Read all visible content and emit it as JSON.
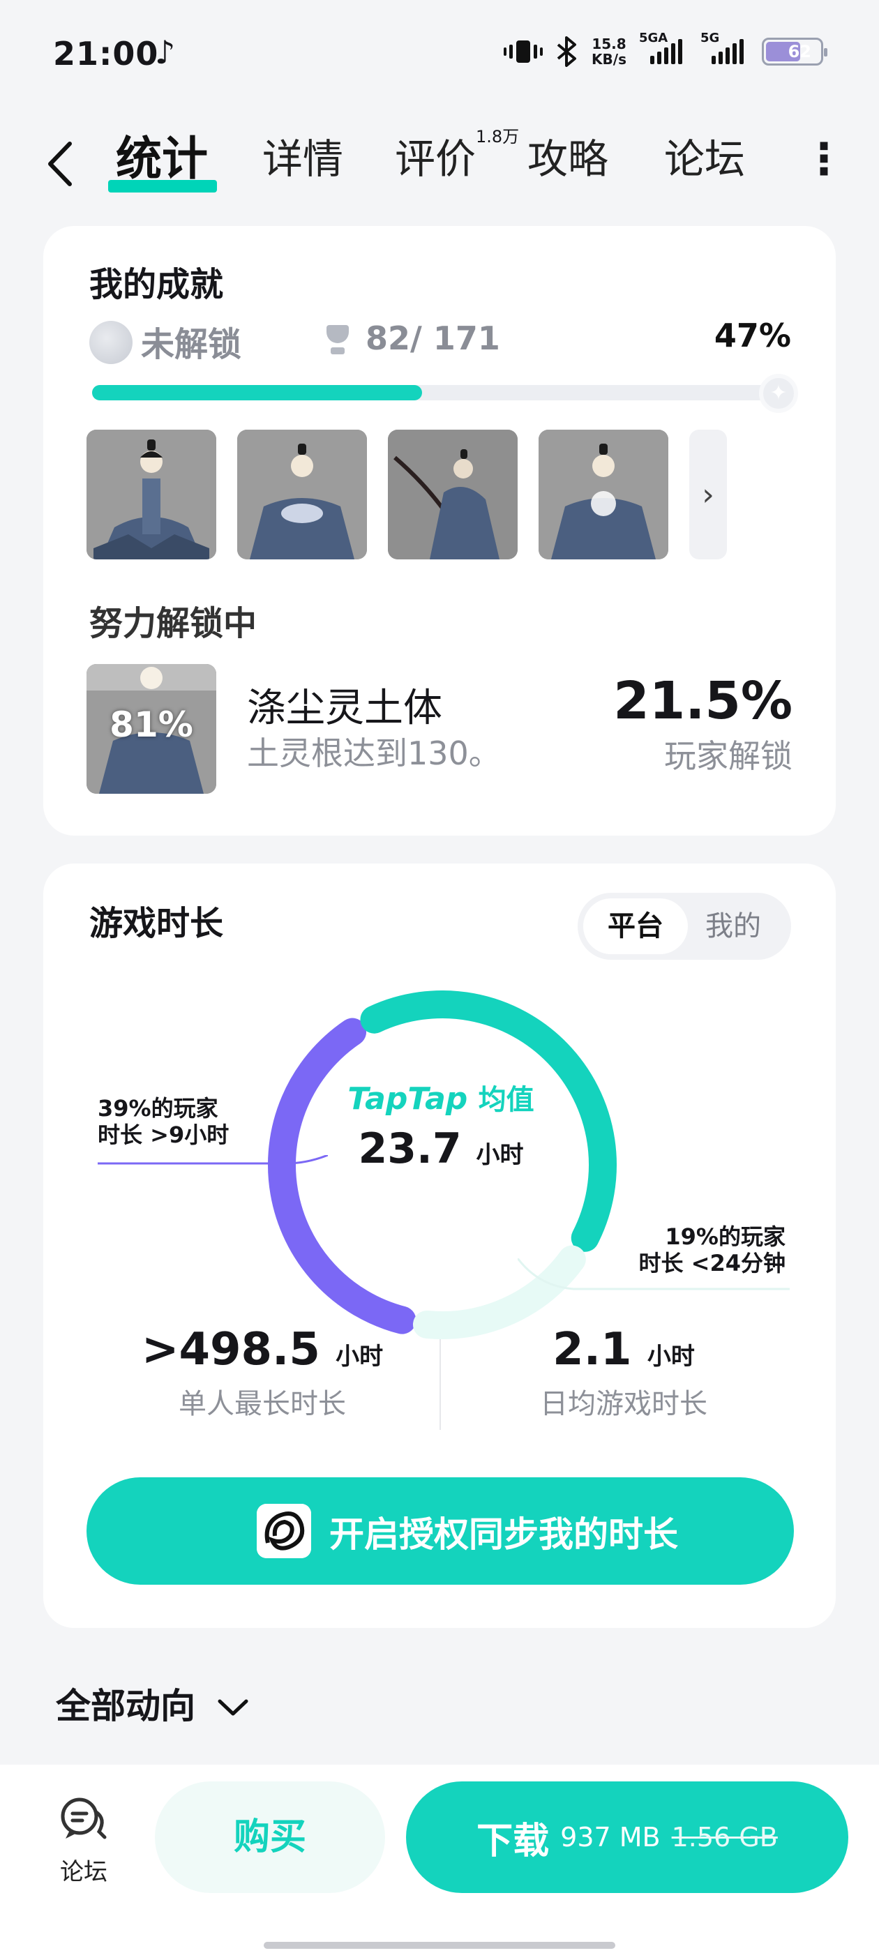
{
  "status_bar": {
    "time": "21:00",
    "notification_icon": "tiktok-icon",
    "speed_value": "15.8",
    "speed_unit": "KB/s",
    "signal1_label": "5GA",
    "signal2_label": "5G",
    "battery": "62",
    "battery_color": "#9b8fd8"
  },
  "nav": {
    "tabs": [
      {
        "label": "统计"
      },
      {
        "label": "详情"
      },
      {
        "label": "评价"
      },
      {
        "label": "攻略"
      },
      {
        "label": "论坛"
      }
    ],
    "review_count": "1.8万",
    "accent": "#00d4b8"
  },
  "achievements": {
    "title": "我的成就",
    "unlocked_label": "未解锁",
    "count": "82/ 171",
    "percent_text": "47%",
    "progress_fraction": 0.47,
    "in_progress_title": "努力解锁中",
    "in_progress": {
      "progress_label": "81%",
      "name": "涤尘灵土体",
      "desc": "土灵根达到130。",
      "rate": "21.5%",
      "rate_label": "玩家解锁"
    }
  },
  "playtime": {
    "title": "游戏时长",
    "toggle": [
      "平台",
      "我的"
    ],
    "center_brand": "TapTap",
    "center_label": "均值",
    "center_value": "23.7",
    "center_unit": "小时",
    "left_label_line1": "39%的玩家",
    "left_label_line2": "时长 >9小时",
    "right_label_line1": "19%的玩家",
    "right_label_line2": "时长 <24分钟",
    "segments": [
      {
        "share": 0.39,
        "color": "#7b68f5"
      },
      {
        "share": 0.42,
        "color": "#14d3bd"
      },
      {
        "share": 0.19,
        "color": "#e7faf6"
      }
    ],
    "stats": [
      {
        "prefix": ">",
        "value": "498.5",
        "unit": "小时",
        "label": "单人最长时长"
      },
      {
        "prefix": "",
        "value": "2.1",
        "unit": "小时",
        "label": "日均游戏时长"
      }
    ],
    "sync_button": "开启授权同步我的时长"
  },
  "feed": {
    "title": "全部动向"
  },
  "bottom_bar": {
    "forum_label": "论坛",
    "buy_label": "购买",
    "download_label": "下载",
    "download_size": "937 MB",
    "original_size": "1.56 GB"
  }
}
